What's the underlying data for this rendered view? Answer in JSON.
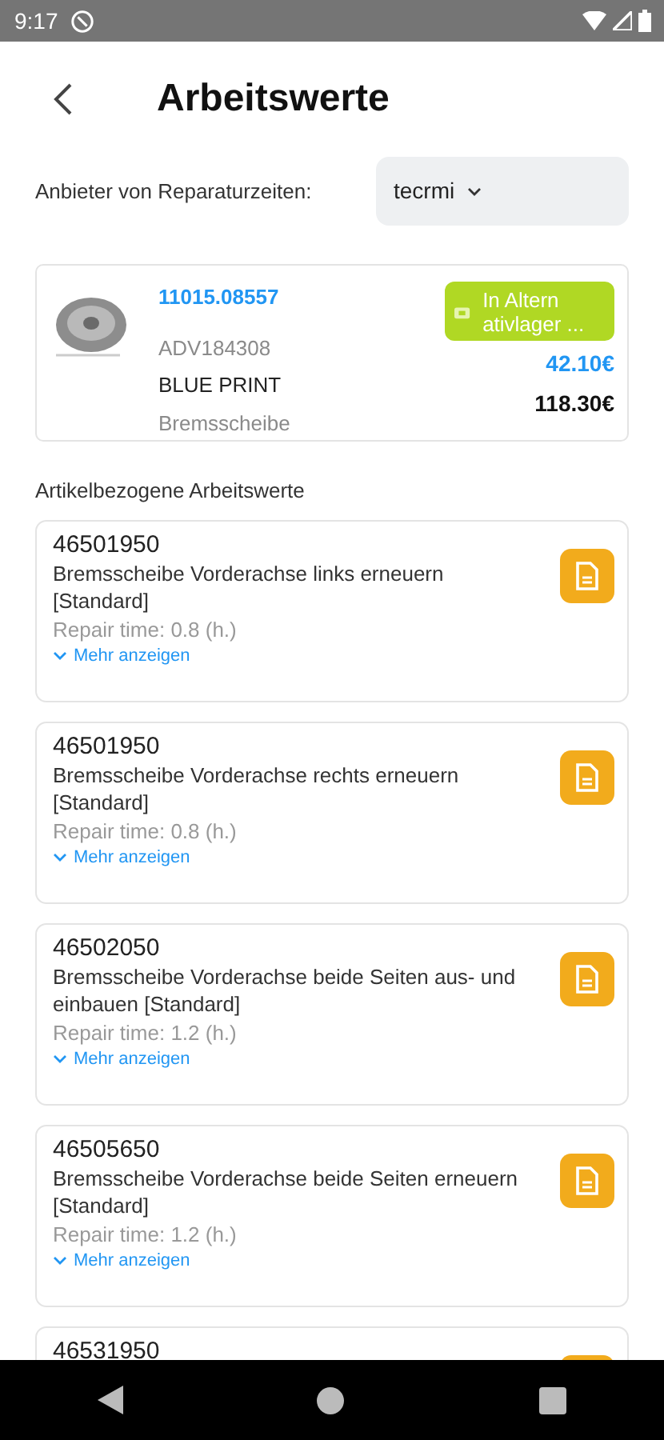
{
  "status_bar": {
    "time": "9:17"
  },
  "header": {
    "title": "Arbeitswerte"
  },
  "provider": {
    "label": "Anbieter von Reparaturzeiten:",
    "value": "tecrmi"
  },
  "product": {
    "number": "11015.08557",
    "ref": "ADV184308",
    "brand": "BLUE PRINT",
    "name": "Bremsscheibe",
    "badge": "In Altern ativlager ...",
    "price": "42.10€",
    "list_price": "118.30€"
  },
  "section_title": "Artikelbezogene Arbeitswerte",
  "work_items": [
    {
      "code": "46501950",
      "description": "Bremsscheibe Vorderachse links erneuern [Standard]",
      "repair_time": "Repair time: 0.8 (h.)",
      "more": "Mehr anzeigen"
    },
    {
      "code": "46501950",
      "description": "Bremsscheibe Vorderachse rechts erneuern [Standard]",
      "repair_time": "Repair time: 0.8 (h.)",
      "more": "Mehr anzeigen"
    },
    {
      "code": "46502050",
      "description": "Bremsscheibe Vorderachse beide Seiten aus- und einbauen [Standard]",
      "repair_time": "Repair time: 1.2 (h.)",
      "more": "Mehr anzeigen"
    },
    {
      "code": "46505650",
      "description": "Bremsscheibe Vorderachse beide Seiten erneuern [Standard]",
      "repair_time": "Repair time: 1.2 (h.)",
      "more": "Mehr anzeigen"
    },
    {
      "code": "46531950"
    }
  ]
}
